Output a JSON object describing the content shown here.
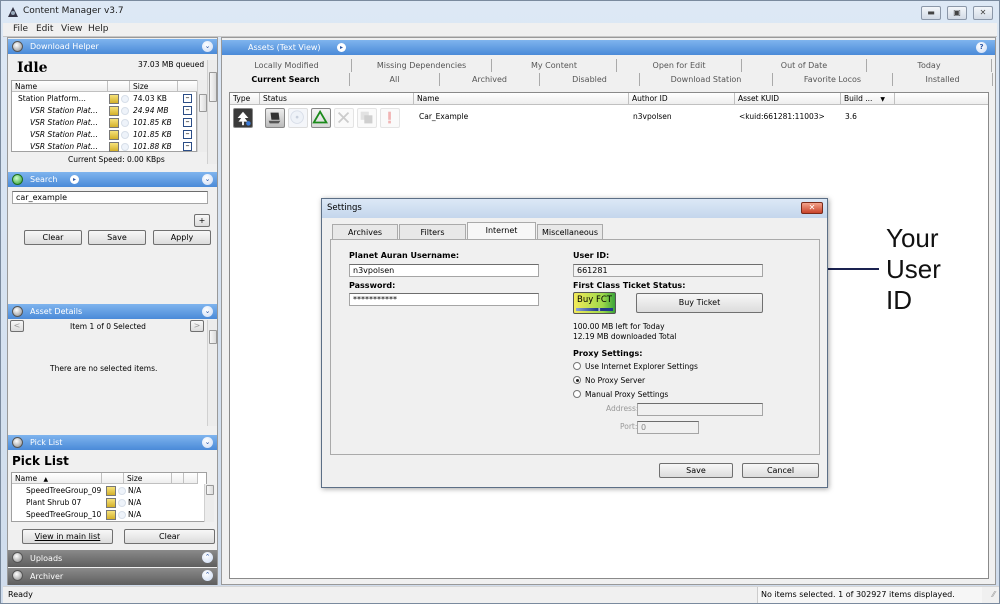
{
  "window": {
    "title": "Content Manager v3.7",
    "controls": {
      "minimize": "▬",
      "maximize": "▣",
      "close": "✕"
    }
  },
  "menu": [
    "File",
    "Edit",
    "View",
    "Help"
  ],
  "download_helper": {
    "header": "Download Helper",
    "state": "Idle",
    "queued": "37.03 MB queued",
    "columns": [
      "Name",
      "",
      "Size",
      ""
    ],
    "rows": [
      {
        "name": "Station Platform...",
        "size": "74.03 KB",
        "italic": false
      },
      {
        "name": "VSR Station Plat...",
        "size": "24.94 MB",
        "italic": true
      },
      {
        "name": "VSR Station Plat...",
        "size": "101.85 KB",
        "italic": true
      },
      {
        "name": "VSR Station Plat...",
        "size": "101.85 KB",
        "italic": true
      },
      {
        "name": "VSR Station Plat...",
        "size": "101.88 KB",
        "italic": true
      }
    ],
    "speed": "Current Speed: 0.00 KBps"
  },
  "search": {
    "header": "Search",
    "value": "car_example",
    "add_label": "+",
    "clear_label": "Clear",
    "save_label": "Save",
    "apply_label": "Apply"
  },
  "asset_details": {
    "header": "Asset Details",
    "nav": "Item 1 of 0 Selected",
    "prev": "<",
    "next": ">",
    "empty": "There are no selected items."
  },
  "pick_list": {
    "header": "Pick List",
    "title": "Pick List",
    "columns": [
      "Name",
      "",
      "Size",
      "",
      ""
    ],
    "sort_indicator": "▲",
    "rows": [
      {
        "name": "SpeedTreeGroup_09",
        "size": "N/A"
      },
      {
        "name": "Plant Shrub 07",
        "size": "N/A"
      },
      {
        "name": "SpeedTreeGroup_10",
        "size": "N/A"
      }
    ],
    "view_label": "View in main list",
    "clear_label": "Clear"
  },
  "uploads": {
    "header": "Uploads"
  },
  "archiver": {
    "header": "Archiver"
  },
  "assets": {
    "header": "Assets (Text View)",
    "help": "?",
    "tabs_row1": [
      "Locally Modified",
      "Missing Dependencies",
      "My Content",
      "Open for Edit",
      "Out of Date",
      "Today"
    ],
    "tabs_row2": [
      "Current Search",
      "All",
      "Archived",
      "Disabled",
      "Download Station",
      "Favorite Locos",
      "Installed"
    ],
    "active_tab": "Current Search",
    "columns": [
      "Type",
      "Status",
      "Name",
      "Author ID",
      "Asset KUID",
      "Build ..."
    ],
    "sort_indicator": "▼",
    "rows": [
      {
        "name": "Car_Example",
        "author": "n3vpolsen",
        "kuid": "<kuid:661281:11003>",
        "build": "3.6"
      }
    ]
  },
  "settings_dialog": {
    "title": "Settings",
    "close": "✕",
    "tabs": [
      "Archives",
      "Filters",
      "Internet",
      "Miscellaneous"
    ],
    "active_tab": "Internet",
    "username_label": "Planet Auran Username:",
    "username": "n3vpolsen",
    "password_label": "Password:",
    "password": "***********",
    "userid_label": "User ID:",
    "userid": "661281",
    "fct_label": "First Class Ticket Status:",
    "buy_fct": "Buy FCT",
    "buy_ticket": "Buy Ticket",
    "left_today": "100.00 MB left for Today",
    "downloaded_total": "12.19 MB downloaded Total",
    "proxy_label": "Proxy Settings:",
    "proxy_options": [
      {
        "label": "Use Internet Explorer Settings",
        "selected": false
      },
      {
        "label": "No Proxy Server",
        "selected": true
      },
      {
        "label": "Manual Proxy Settings",
        "selected": false
      }
    ],
    "address_label": "Address:",
    "address": "",
    "port_label": "Port:",
    "port": "0",
    "save_label": "Save",
    "cancel_label": "Cancel"
  },
  "annotation": {
    "lines": [
      "Your",
      "User",
      "ID"
    ],
    "arrow_color": "#1a2250"
  },
  "status": {
    "left": "Ready",
    "right": "No items selected. 1 of 302927 items displayed."
  }
}
